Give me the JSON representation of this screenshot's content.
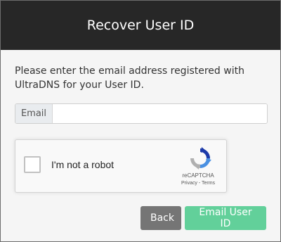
{
  "modal": {
    "title": "Recover User ID",
    "instructions": "Please enter the email address registered with UltraDNS for your User ID.",
    "email": {
      "label": "Email",
      "value": "",
      "placeholder": ""
    },
    "recaptcha": {
      "label": "I'm not a robot",
      "checked": false,
      "brand": "reCAPTCHA",
      "links": "Privacy - Terms",
      "logo_icon": "recaptcha-logo-icon"
    },
    "buttons": {
      "back": "Back",
      "submit": "Email User ID"
    }
  },
  "colors": {
    "header_bg": "#272727",
    "back_button": "#757575",
    "submit_button": "#62d09a",
    "recaptcha_blue": "#4a90e2"
  }
}
